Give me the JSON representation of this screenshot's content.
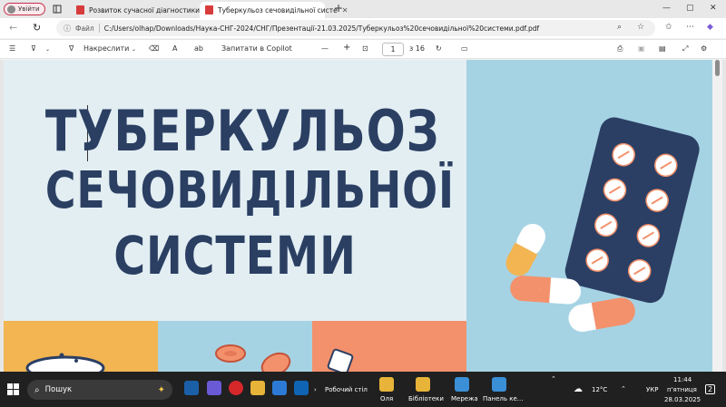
{
  "browser": {
    "profile_label": "Увійти",
    "tabs": [
      {
        "title": "Розвиток сучасної діагностики ту"
      },
      {
        "title": "Туберкульоз сечовидільної систе"
      }
    ],
    "new_tab": "+",
    "window_controls": [
      "—",
      "▢",
      "✕"
    ]
  },
  "addressbar": {
    "scheme_label": "Файл",
    "url": "C:/Users/olhap/Downloads/Наука-СНГ-2024/СНГ/Презентації-21.03.2025/Туберкульоз%20сечовидільної%20системи.pdf.pdf"
  },
  "pdf_toolbar": {
    "draw_label": "Накреслити",
    "copilot_label": "Запитати в Copilot",
    "zoom_out": "—",
    "zoom_in": "+",
    "page_current": "1",
    "page_total": "з 16"
  },
  "slide": {
    "title_lines": [
      "ТУБЕРКУЛЬОЗ",
      "СЕЧОВИДІЛЬНОЇ",
      "СИСТЕМИ"
    ],
    "colors": {
      "left_bg": "#e3eef3",
      "right_bg": "#a6d3e3",
      "title": "#2a3f62",
      "band_yellow": "#f2b552",
      "band_blue": "#a6d3e3",
      "band_salmon": "#f3916c",
      "blister": "#2b3f64"
    }
  },
  "taskbar": {
    "search_label": "Пошук",
    "desktop_label": "Робочий стіл",
    "pins": [
      {
        "label": "Оля"
      },
      {
        "label": "Бібліотеки"
      },
      {
        "label": "Мережа"
      },
      {
        "label": "Панель ке..."
      }
    ],
    "weather": "12°C",
    "language": "УКР",
    "time": "11:44",
    "day": "п'ятниця",
    "date": "28.03.2025",
    "notif_count": "2"
  }
}
